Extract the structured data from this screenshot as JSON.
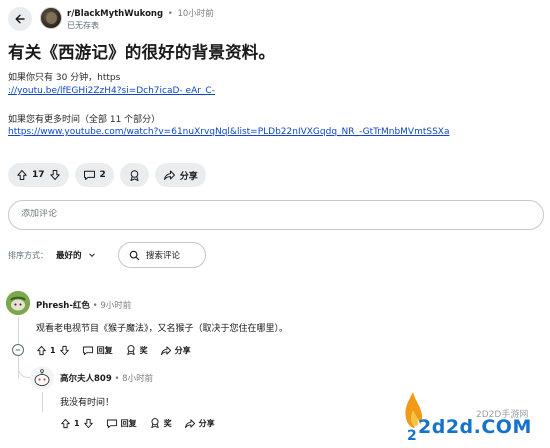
{
  "header": {
    "subreddit": "r/BlackMythWukong",
    "dot": "•",
    "time": "10小时前",
    "flair": "已无存表"
  },
  "post": {
    "title": "有关《西游记》的很好的背景资料。",
    "line1": "如果你只有 30 分钟，https",
    "link1": "://youtu.be/lfEGHi2ZzH4?si=Dch7icaD- eAr_C-",
    "line2": "如果您有更多时间（全部 11 个部分）",
    "link2": "https://www.youtube.com/watch?v=61nuXrvqNql&list=PLDb22nIVXGqdq_NR_-GtTrMnbMVmtSSXa"
  },
  "actions": {
    "vote_count": "17",
    "comment_count": "2",
    "share_label": "分享"
  },
  "comment_box": {
    "placeholder": "添加评论"
  },
  "sort": {
    "label": "排序方式：",
    "selected": "最好的",
    "search_label": "搜索评论"
  },
  "comments": [
    {
      "author": "Phresh-红色",
      "dot": "•",
      "time": "9小时前",
      "text": "观看老电视节目《猴子魔法》，又名猴子（取决于您住在哪里）。",
      "votes": "1",
      "reply_label": "回复",
      "award_label": "奖",
      "share_label": "分享"
    },
    {
      "author": "高尔夫人809",
      "dot": "•",
      "time": "8小时前",
      "text": "我没有时间！",
      "votes": "1",
      "reply_label": "回复",
      "award_label": "奖",
      "share_label": "分享"
    }
  ],
  "watermark": {
    "top": "2D2D手游网",
    "main": "2d2d.COM"
  },
  "colors": {
    "link": "#0e47c9",
    "pill_bg": "#eaedef",
    "muted": "#576f76",
    "watermark_blue": "#1673c9"
  }
}
